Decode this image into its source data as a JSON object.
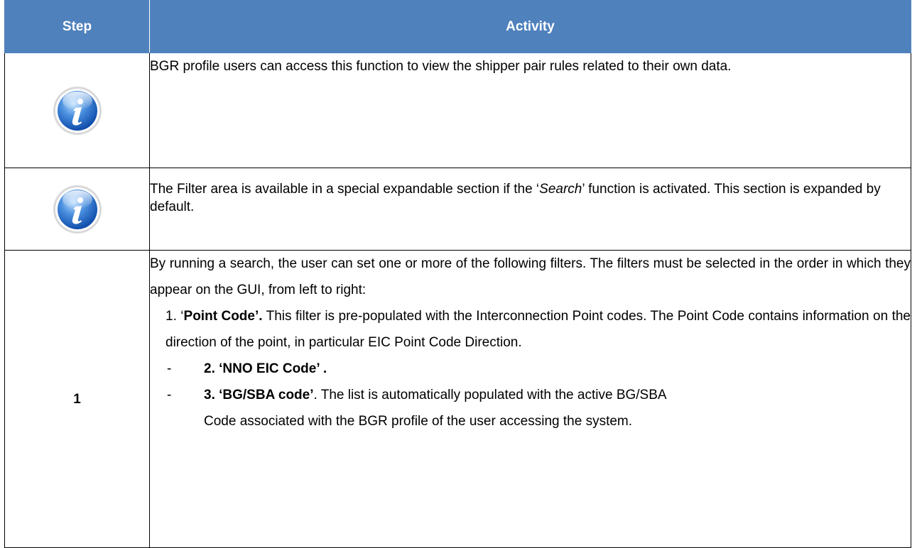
{
  "header": {
    "step": "Step",
    "activity": "Activity"
  },
  "rows": [
    {
      "icon": "info-icon",
      "text": "BGR profile users can access this function to view the shipper pair rules related to their own data."
    },
    {
      "icon": "info-icon",
      "pre": "The Filter area is available in a special expandable section if the ‘",
      "em": "Search",
      "post": "’ function is activated. This section is expanded by default."
    },
    {
      "step": "1",
      "intro": "By running a search, the user can set one or more of the following filters. The filters must be selected in the order in which they appear on the GUI, from left to right:",
      "item1_prefix": "1. ‘",
      "item1_bold": "Point Code’.",
      "item1_text": " This filter is pre-populated with the Interconnection Point codes. The Point Code contains information on the direction of the point, in particular EIC Point Code Direction.",
      "dash": "-",
      "item2_bold": "2. ‘NNO EIC Code’ .",
      "item3_bold": "3. ‘BG/SBA code’",
      "item3_text": ". The list is automatically populated with the active BG/SBA",
      "item3_cont": "Code associated with the BGR profile of the user accessing the system."
    }
  ],
  "colors": {
    "header_bg": "#4f81bd",
    "header_text": "#ffffff",
    "border": "#000000"
  }
}
